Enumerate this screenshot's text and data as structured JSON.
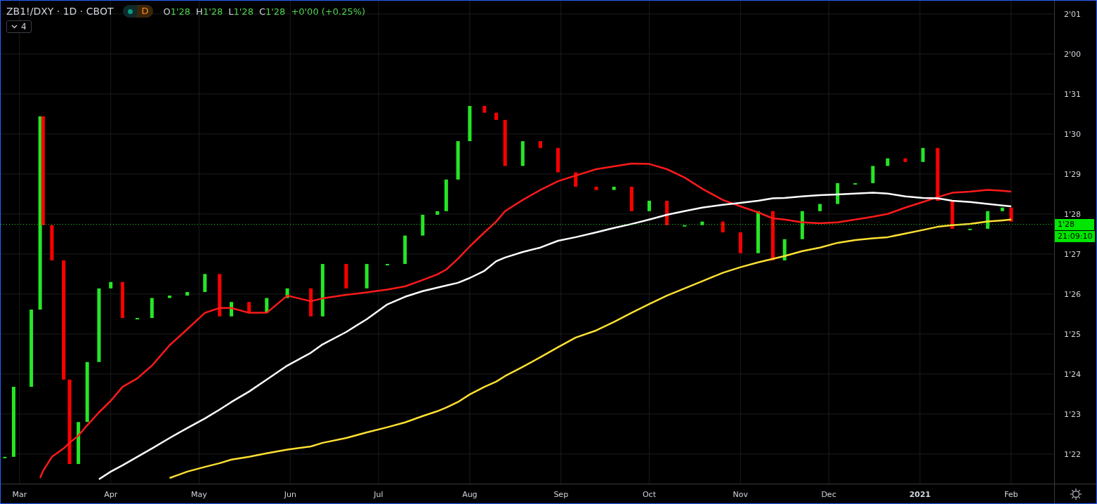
{
  "legend": {
    "symbol": "ZB1!/DXY · 1D · CBOT",
    "interval_badge": "D",
    "ohlc": [
      {
        "label": "O",
        "value": "1'28"
      },
      {
        "label": "H",
        "value": "1'28"
      },
      {
        "label": "L",
        "value": "1'28"
      },
      {
        "label": "C",
        "value": "1'28"
      }
    ],
    "change": "+0'00 (+0.25%)",
    "collapse_button": {
      "count": "4",
      "expanded": false
    }
  },
  "price_scale": {
    "labels": [
      "2'01",
      "2'00",
      "1'31",
      "1'30",
      "1'29",
      "1'28",
      "1'27",
      "1'26",
      "1'25",
      "1'24",
      "1'23",
      "1'22"
    ],
    "last_price": "1'28",
    "countdown": "21:09:10"
  },
  "time_scale": {
    "labels": [
      {
        "text": "Mar",
        "bold": false
      },
      {
        "text": "Apr",
        "bold": false
      },
      {
        "text": "May",
        "bold": false
      },
      {
        "text": "Jun",
        "bold": false
      },
      {
        "text": "Jul",
        "bold": false
      },
      {
        "text": "Aug",
        "bold": false
      },
      {
        "text": "Sep",
        "bold": false
      },
      {
        "text": "Oct",
        "bold": false
      },
      {
        "text": "Nov",
        "bold": false
      },
      {
        "text": "Dec",
        "bold": false
      },
      {
        "text": "2021",
        "bold": true
      },
      {
        "text": "Feb",
        "bold": false
      }
    ]
  }
}
